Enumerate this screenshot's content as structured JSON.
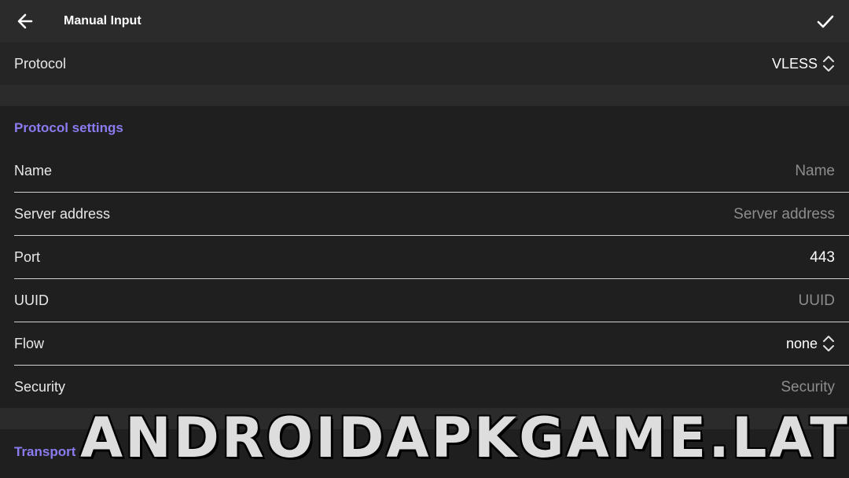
{
  "header": {
    "title": "Manual Input",
    "back_icon": "arrow-left-icon",
    "confirm_icon": "check-icon"
  },
  "protocol": {
    "label": "Protocol",
    "value": "VLESS"
  },
  "protocol_settings": {
    "title": "Protocol settings",
    "fields": [
      {
        "label": "Name",
        "placeholder": "Name",
        "value": ""
      },
      {
        "label": "Server address",
        "placeholder": "Server address",
        "value": ""
      },
      {
        "label": "Port",
        "placeholder": "",
        "value": "443"
      },
      {
        "label": "UUID",
        "placeholder": "UUID",
        "value": ""
      },
      {
        "label": "Flow",
        "value": "none"
      },
      {
        "label": "Security",
        "placeholder": "Security",
        "value": ""
      }
    ]
  },
  "transport": {
    "title": "Transport"
  },
  "watermark": "ANDROIDAPKGAME.LAT",
  "colors": {
    "background": "#1f1f1f",
    "topbar": "#2b2b2b",
    "accent": "#8a7cf0"
  }
}
